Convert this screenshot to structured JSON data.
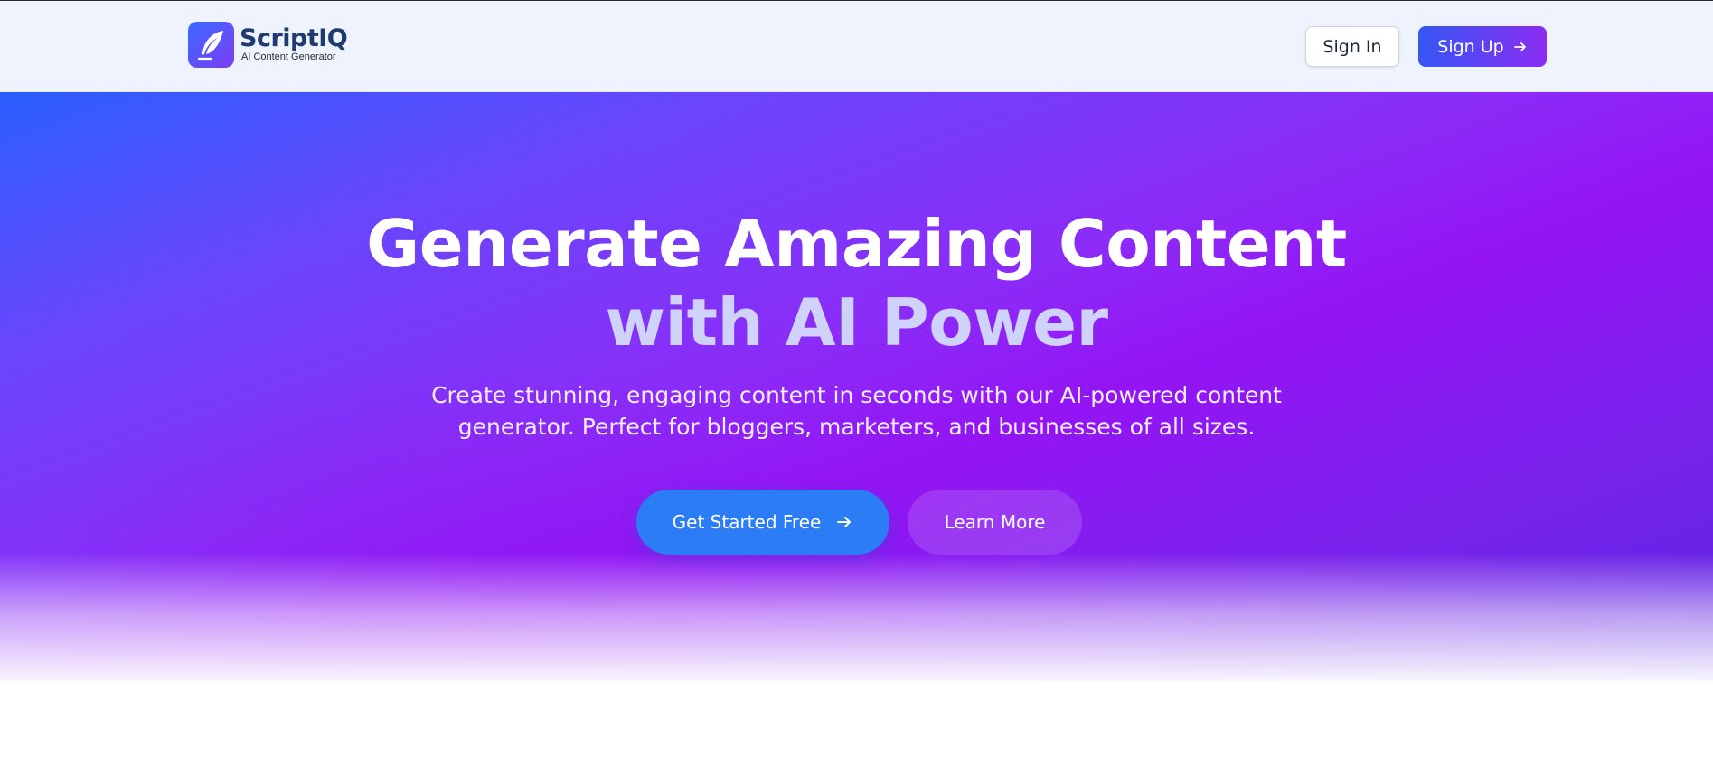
{
  "header": {
    "brand_name": "ScriptIQ",
    "brand_tagline": "AI Content Generator",
    "logo_icon": "quill-feather-icon",
    "signin_label": "Sign In",
    "signup_label": "Sign Up",
    "signup_icon": "arrow-right-icon"
  },
  "hero": {
    "headline_line1": "Generate Amazing Content",
    "headline_line2": "with AI Power",
    "subtext": "Create stunning, engaging content in seconds with our AI-powered content generator. Perfect for bloggers, marketers, and businesses of all sizes.",
    "primary_cta_label": "Get Started Free",
    "primary_cta_icon": "arrow-right-icon",
    "secondary_cta_label": "Learn More"
  },
  "colors": {
    "brand_gradient_start": "#3657f5",
    "brand_gradient_end": "#8a2cf1",
    "primary_cta": "#2c7cf6",
    "headline_accent": "#cfd3fb",
    "header_bg": "#eef3fd"
  }
}
